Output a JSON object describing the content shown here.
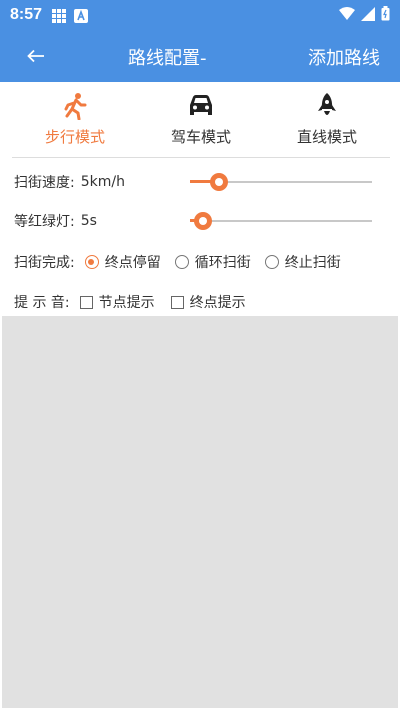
{
  "status_bar": {
    "time": "8:57",
    "icons": [
      "grid-icon",
      "a-icon",
      "wifi-icon",
      "signal-icon",
      "battery-icon"
    ]
  },
  "app_bar": {
    "back_icon": "arrow-left-icon",
    "title": "路线配置-",
    "action": "添加路线"
  },
  "modes": [
    {
      "label": "步行模式",
      "icon": "walk-icon",
      "active": true
    },
    {
      "label": "驾车模式",
      "icon": "car-icon",
      "active": false
    },
    {
      "label": "直线模式",
      "icon": "rocket-icon",
      "active": false
    }
  ],
  "speed": {
    "label": "扫街速度:",
    "value": "5km/h",
    "level": 0.16
  },
  "light": {
    "label": "等红绿灯:",
    "value": "5s",
    "level": 0.07
  },
  "completion": {
    "label": "扫街完成:",
    "options": [
      {
        "label": "终点停留",
        "checked": true
      },
      {
        "label": "循环扫街",
        "checked": false
      },
      {
        "label": "终止扫街",
        "checked": false
      }
    ]
  },
  "sound": {
    "label": "提 示 音:",
    "options": [
      {
        "label": "节点提示",
        "checked": false
      },
      {
        "label": "终点提示",
        "checked": false
      }
    ]
  },
  "colors": {
    "primary": "#4a90e2",
    "accent": "#f07a3f",
    "map_bg": "#e1e1e1"
  }
}
